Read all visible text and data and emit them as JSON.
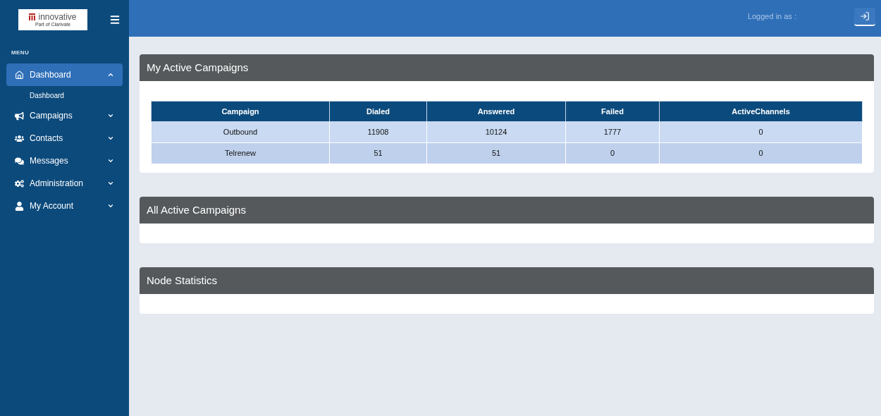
{
  "logo": {
    "name": "innovative",
    "tagline": "Part of Clarivate"
  },
  "sidebar": {
    "heading": "MENU",
    "items": [
      {
        "label": "Dashboard",
        "selected": true,
        "expanded": true,
        "children": [
          {
            "label": "Dashboard"
          }
        ]
      },
      {
        "label": "Campaigns",
        "selected": false,
        "expanded": false
      },
      {
        "label": "Contacts",
        "selected": false,
        "expanded": false
      },
      {
        "label": "Messages",
        "selected": false,
        "expanded": false
      },
      {
        "label": "Administration",
        "selected": false,
        "expanded": false
      },
      {
        "label": "My Account",
        "selected": false,
        "expanded": false
      }
    ]
  },
  "header": {
    "logged_in": "Logged in as :"
  },
  "panels": [
    {
      "title": "My Active Campaigns",
      "table": {
        "columns": [
          "Campaign",
          "Dialed",
          "Answered",
          "Failed",
          "ActiveChannels"
        ],
        "rows": [
          [
            "Outbound",
            "11908",
            "10124",
            "1777",
            "0"
          ],
          [
            "Telrenew",
            "51",
            "51",
            "0",
            "0"
          ]
        ]
      }
    },
    {
      "title": "All Active Campaigns"
    },
    {
      "title": "Node Statistics"
    }
  ]
}
